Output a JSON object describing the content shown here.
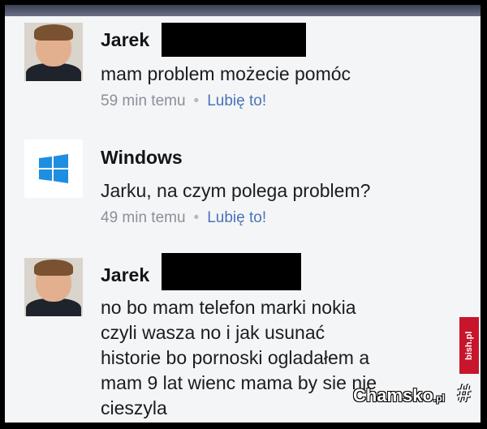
{
  "comments": [
    {
      "author": "Jarek",
      "avatar_icon": "boy-avatar",
      "message_lines": [
        "mam problem możecie pomóc"
      ],
      "time": "59 min temu",
      "like_label": "Lubię to!"
    },
    {
      "author": "Windows",
      "avatar_icon": "windows-logo-icon",
      "message_lines": [
        "Jarku, na czym polega problem?"
      ],
      "time": "49 min temu",
      "like_label": "Lubię to!"
    },
    {
      "author": "Jarek",
      "avatar_icon": "boy-avatar",
      "message_lines": [
        "no bo mam telefon marki nokia",
        "czyli wasza no i jak usunać",
        "historie  bo pornoski ogladałem a",
        "mam 9 lat wienc mama by sie nie",
        "cieszyla"
      ]
    }
  ],
  "watermark": {
    "name": "Chamsko",
    "tld": ".pl",
    "vertical_text": "bish.pl"
  },
  "colors": {
    "background": "#f4f5f7",
    "link": "#4a72b8",
    "meta": "#8c8f99",
    "windows_blue": "#1e8ee0"
  }
}
